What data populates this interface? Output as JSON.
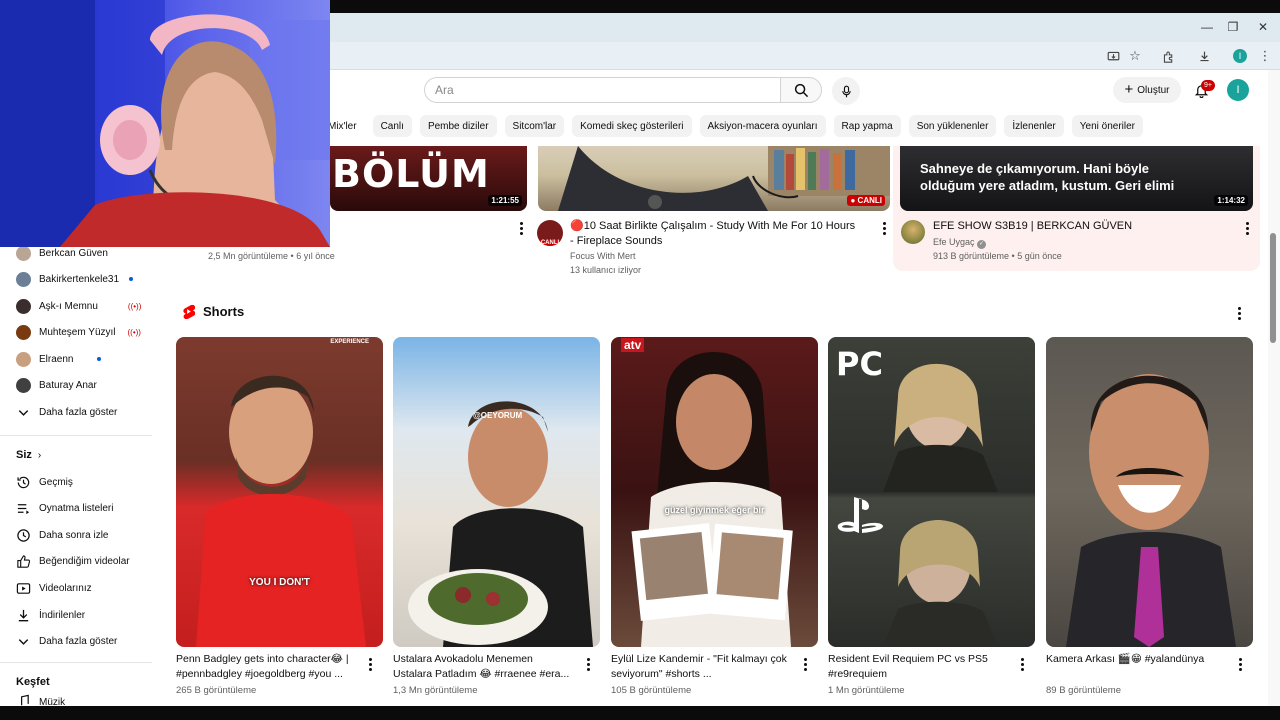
{
  "window": {
    "minimize_icon": "minimize-icon",
    "restore_icon": "restore-icon",
    "close_icon": "close-icon"
  },
  "toolbar": {
    "profile_letter": "I"
  },
  "masthead": {
    "search_placeholder": "Ara",
    "create_label": "Oluştur",
    "notification_count": "9+",
    "avatar_letter": "I"
  },
  "chips": [
    "Mix'ler",
    "Canlı",
    "Pembe diziler",
    "Sitcom'lar",
    "Komedi skeç gösterileri",
    "Aksiyon-macera oyunları",
    "Rap yapma",
    "Son yüklenenler",
    "İzlenenler",
    "Yeni öneriler"
  ],
  "sidebar": {
    "subscriptions": [
      {
        "name": "Berkcan Güven",
        "badge": "",
        "color": "#b8a593"
      },
      {
        "name": "Bakirkertenkele31",
        "badge": "dot",
        "color": "#6d7f97"
      },
      {
        "name": "Aşk-ı Memnu",
        "badge": "live",
        "color": "#3a2d2d"
      },
      {
        "name": "Muhteşem Yüzyıl",
        "badge": "live",
        "color": "#7a3a10"
      },
      {
        "name": "Elraenn",
        "badge": "dot",
        "color": "#c8a080"
      },
      {
        "name": "Baturay Anar",
        "badge": "",
        "color": "#404040"
      }
    ],
    "show_more_1": "Daha fazla göster",
    "you_heading": "Siz",
    "you_items": [
      {
        "label": "Geçmiş",
        "icon": "history-icon"
      },
      {
        "label": "Oynatma listeleri",
        "icon": "playlists-icon"
      },
      {
        "label": "Daha sonra izle",
        "icon": "watch-later-icon"
      },
      {
        "label": "Beğendiğim videolar",
        "icon": "liked-videos-icon"
      },
      {
        "label": "Videolarınız",
        "icon": "your-videos-icon"
      },
      {
        "label": "İndirilenler",
        "icon": "downloads-icon"
      }
    ],
    "show_more_2": "Daha fazla göster",
    "explore_heading": "Keşfet",
    "explore_first": "Müzik"
  },
  "top_videos": [
    {
      "thumb_text": "BÖLÜM",
      "duration": "1:21:55",
      "title": "",
      "channel": "",
      "meta": "2,5 Mn görüntüleme • 6 yıl önce"
    },
    {
      "duration": "CANLI",
      "title": "🔴10 Saat Birlikte Çalışalım - Study With Me For 10 Hours - Fireplace Sounds",
      "channel": "Focus With Mert",
      "meta": "13 kullanıcı izliyor",
      "avatar_badge": "CANLI"
    },
    {
      "thumb_text": "Sahneye de çıkamıyorum. Hani böyle olduğum yere atladım, kustum. Geri elimi",
      "duration": "1:14:32",
      "title": "EFE SHOW S3B19 | BERKCAN GÜVEN",
      "channel": "Efe Uygaç",
      "meta": "913 B görüntüleme • 5 gün önce"
    }
  ],
  "shorts": {
    "heading": "Shorts",
    "items": [
      {
        "title": "Penn Badgley gets into character😂 | #pennbadgley #joegoldberg #you ...",
        "views": "265 B görüntüleme",
        "overlay": "YOU I DON'T",
        "corner": "EXPERIENCE"
      },
      {
        "title": "Ustalara Avokadolu Menemen Ustalara Patladım 😂 #rraenee #era...",
        "views": "1,3 Mn görüntüleme",
        "overlay": "@OEYORUM",
        "corner": ""
      },
      {
        "title": "Eylül Lize Kandemir - \"Fit kalmayı çok seviyorum\" #shorts ...",
        "views": "105 B görüntüleme",
        "overlay": "güzel giyinmek eğer bir",
        "corner": "atv"
      },
      {
        "title": "Resident Evil Requiem PC vs PS5 #re9requiem",
        "views": "1 Mn görüntüleme",
        "overlay": "",
        "corner": "PC"
      },
      {
        "title": "Kamera Arkası 🎬😁 #yalandünya",
        "views": "89 B görüntüleme",
        "overlay": "",
        "corner": ""
      }
    ]
  }
}
